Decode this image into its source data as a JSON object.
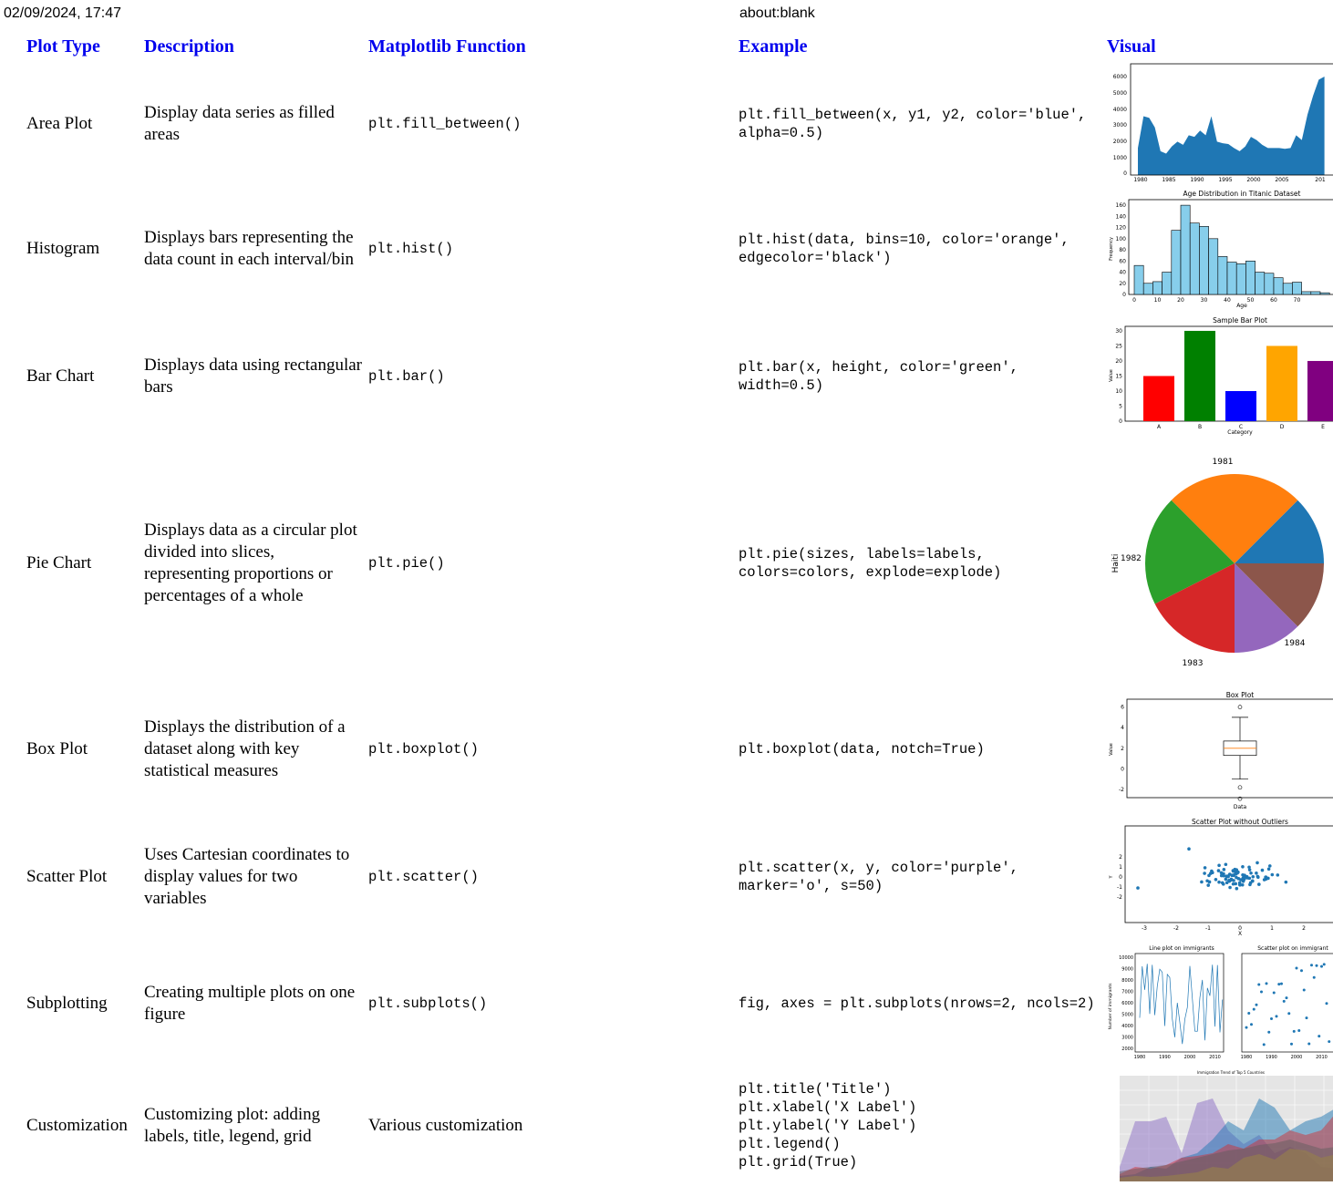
{
  "browser": {
    "timestamp": "02/09/2024, 17:47",
    "address": "about:blank"
  },
  "headers": {
    "plot_type": "Plot Type",
    "description": "Description",
    "function": "Matplotlib Function",
    "example": "Example",
    "visual": "Visual"
  },
  "rows": [
    {
      "type": "Area Plot",
      "description": "Display data series as filled areas",
      "function": "plt.fill_between()",
      "example": "plt.fill_between(x, y1, y2, color='blue', alpha=0.5)"
    },
    {
      "type": "Histogram",
      "description": "Displays bars representing the data count in each interval/bin",
      "function": "plt.hist()",
      "example": "plt.hist(data, bins=10, color='orange', edgecolor='black')"
    },
    {
      "type": "Bar Chart",
      "description": "Displays data using rectangular bars",
      "function": "plt.bar()",
      "example": "plt.bar(x, height, color='green', width=0.5)"
    },
    {
      "type": "Pie Chart",
      "description": "Displays data as a circular plot divided into slices, representing proportions or percentages of a whole",
      "function": "plt.pie()",
      "example": "plt.pie(sizes, labels=labels, colors=colors, explode=explode)"
    },
    {
      "type": "Box Plot",
      "description": "Displays the distribution of a dataset along with key statistical measures",
      "function": "plt.boxplot()",
      "example": "plt.boxplot(data, notch=True)"
    },
    {
      "type": "Scatter Plot",
      "description": "Uses Cartesian coordinates to display values for two variables",
      "function": "plt.scatter()",
      "example": "plt.scatter(x, y, color='purple', marker='o', s=50)"
    },
    {
      "type": "Subplotting",
      "description": "Creating multiple plots on one figure",
      "function": "plt.subplots()",
      "example": "fig, axes = plt.subplots(nrows=2, ncols=2)"
    },
    {
      "type": "Customization",
      "description": "Customizing plot: adding labels, title, legend, grid",
      "function": "Various customization",
      "example": "plt.title('Title')\nplt.xlabel('X Label')\nplt.ylabel('Y Label')\nplt.legend()\nplt.grid(True)"
    }
  ],
  "visuals": {
    "area": {
      "x_ticks": [
        "1980",
        "1985",
        "1990",
        "1995",
        "2000",
        "2005",
        "201"
      ],
      "y_ticks": [
        "0",
        "1000",
        "2000",
        "3000",
        "4000",
        "5000",
        "6000"
      ],
      "x": [
        1980,
        1981,
        1982,
        1983,
        1984,
        1985,
        1986,
        1987,
        1988,
        1989,
        1990,
        1991,
        1992,
        1993,
        1994,
        1995,
        1996,
        1997,
        1998,
        1999,
        2000,
        2001,
        2002,
        2003,
        2004,
        2005,
        2006,
        2007,
        2008,
        2009,
        2010,
        2011,
        2012,
        2013
      ],
      "y": [
        1700,
        3700,
        3600,
        3000,
        1500,
        1350,
        1800,
        2100,
        1900,
        2500,
        2400,
        2800,
        2500,
        3700,
        2100,
        2000,
        1950,
        1700,
        1500,
        1800,
        2400,
        2200,
        1900,
        1700,
        1700,
        1700,
        1650,
        1700,
        2500,
        2200,
        3800,
        5000,
        6000,
        6200
      ],
      "color": "#1f77b4"
    },
    "hist": {
      "title": "Age Distribution in Titanic Dataset",
      "xlabel": "Age",
      "ylabel": "Frequency",
      "x_ticks": [
        "0",
        "10",
        "20",
        "30",
        "40",
        "50",
        "60",
        "70"
      ],
      "y_ticks": [
        "0",
        "20",
        "40",
        "60",
        "80",
        "100",
        "120",
        "140",
        "160"
      ],
      "bin_width": 4,
      "bin_start": 0,
      "counts": [
        52,
        20,
        23,
        40,
        115,
        160,
        128,
        122,
        100,
        68,
        58,
        55,
        60,
        40,
        38,
        30,
        20,
        22,
        5,
        5,
        3
      ],
      "color": "#87ceeb"
    },
    "bar": {
      "title": "Sample Bar Plot",
      "xlabel": "Category",
      "ylabel": "Value",
      "categories": [
        "A",
        "B",
        "C",
        "D",
        "E"
      ],
      "values": [
        15,
        30,
        10,
        25,
        20
      ],
      "colors": [
        "#ff0000",
        "#008000",
        "#0000ff",
        "#ffa500",
        "#800080"
      ],
      "y_ticks": [
        "0",
        "5",
        "10",
        "15",
        "20",
        "25",
        "30"
      ]
    },
    "pie": {
      "ylabel": "Haiti",
      "labels": [
        "1981",
        "1982",
        "1983",
        "1984"
      ],
      "colors": [
        "#1f77b4",
        "#ff7f0e",
        "#2ca02c",
        "#d62728",
        "#9467bd",
        "#8c564b"
      ],
      "fractions": [
        0.125,
        0.25,
        0.2,
        0.175,
        0.125,
        0.125
      ]
    },
    "box": {
      "title": "Box Plot",
      "xlabel": "Data",
      "ylabel": "Value",
      "y_ticks": [
        "-2",
        "0",
        "2",
        "4",
        "6"
      ],
      "q1": 1.3,
      "median": 2.0,
      "q3": 2.7,
      "whisker_low": -1.0,
      "whisker_high": 5.0,
      "outliers": [
        6.0,
        -1.8,
        -2.9
      ]
    },
    "scatter": {
      "title": "Scatter Plot without Outliers",
      "xlabel": "X",
      "ylabel": "Y",
      "x_ticks": [
        "-3",
        "-2",
        "-1",
        "0",
        "1",
        "2"
      ],
      "y_ticks": [
        "-2",
        "-1",
        "0",
        "1",
        "2"
      ]
    },
    "subplots": {
      "left_title": "Line plot on immigrants",
      "right_title": "Scatter plot on immigrant",
      "ylabel": "Number of immigrants",
      "y_ticks": [
        "2000",
        "3000",
        "4000",
        "5000",
        "6000",
        "7000",
        "8000",
        "9000",
        "10000"
      ],
      "x_ticks": [
        "1980",
        "1990",
        "2000",
        "2010"
      ]
    },
    "custom": {
      "title": "Immigration Trend of Top 5 Countries"
    }
  }
}
